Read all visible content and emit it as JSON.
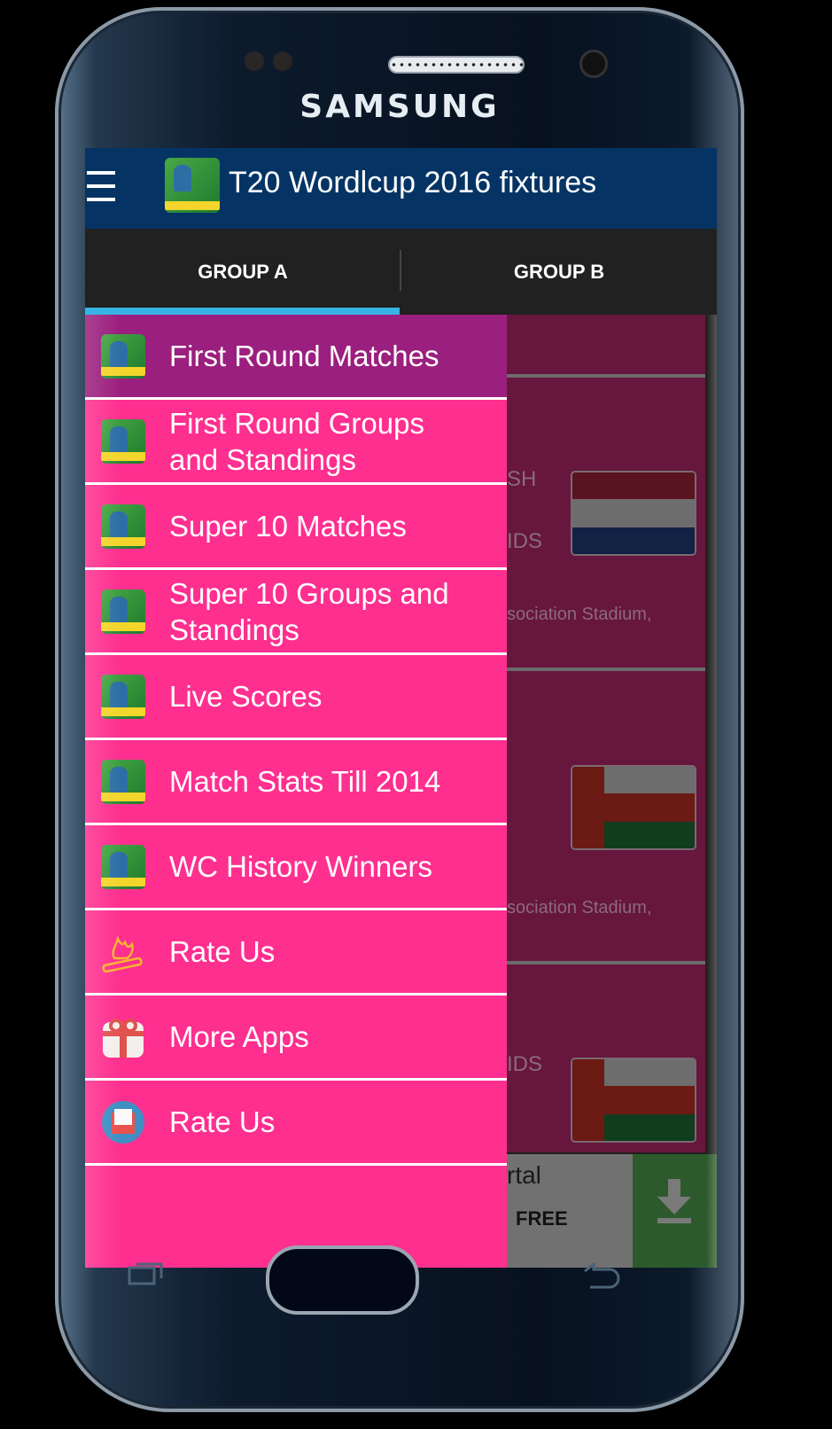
{
  "device": {
    "brand": "SAMSUNG"
  },
  "appbar": {
    "title": "T20 Wordlcup 2016 fixtures",
    "menu_icon": "hamburger-icon",
    "logo_icon": "cricket-logo-icon"
  },
  "tabs": [
    {
      "label": "GROUP A",
      "selected": true
    },
    {
      "label": "GROUP B",
      "selected": false
    }
  ],
  "drawer": {
    "items": [
      {
        "label": "First Round Matches",
        "icon": "cricket-logo-icon",
        "active": true
      },
      {
        "label_line1": "First Round Groups",
        "label_line2": "and Standings",
        "icon": "cricket-logo-icon"
      },
      {
        "label": "Super 10 Matches",
        "icon": "cricket-logo-icon"
      },
      {
        "label_line1": "Super 10 Groups and",
        "label_line2": "Standings",
        "icon": "cricket-logo-icon"
      },
      {
        "label": "Live Scores",
        "icon": "cricket-logo-icon"
      },
      {
        "label": "Match Stats Till 2014",
        "icon": "cricket-logo-icon"
      },
      {
        "label": "WC History Winners",
        "icon": "cricket-logo-icon"
      },
      {
        "label": "Rate Us",
        "icon": "fire-icon"
      },
      {
        "label": "More Apps",
        "icon": "gift-icon"
      },
      {
        "label": "Rate Us",
        "icon": "mail-icon"
      }
    ]
  },
  "background_content": {
    "cards": [
      {
        "team1_partial": "SH",
        "team2_partial": "IDS",
        "venue_partial": "sociation Stadium,",
        "flag": "netherlands-flag"
      },
      {
        "venue_partial": "sociation Stadium,",
        "flag": "oman-flag"
      },
      {
        "team2_partial": "IDS",
        "flag": "oman-flag"
      }
    ],
    "ad": {
      "text_partial": "rtal",
      "cta": "FREE",
      "icon": "download-icon"
    }
  },
  "colors": {
    "appbar": "#053464",
    "tab_indicator": "#38b4e4",
    "drawer": "#fe2f8f",
    "drawer_active": "#9b1f7e",
    "card": "#67163d"
  }
}
